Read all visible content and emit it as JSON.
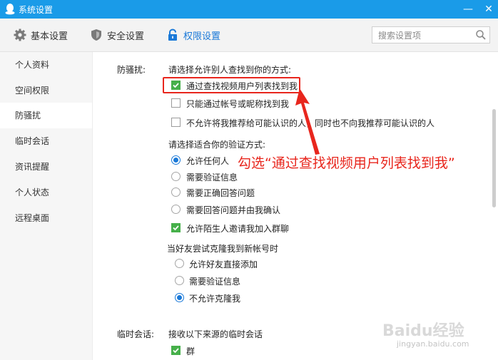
{
  "window": {
    "title": "系统设置",
    "minimize_label": "—",
    "close_label": "✕"
  },
  "toolbar": {
    "tabs": [
      {
        "label": "基本设置",
        "icon": "gear-icon"
      },
      {
        "label": "安全设置",
        "icon": "shield-icon"
      },
      {
        "label": "权限设置",
        "icon": "lock-icon",
        "active": true
      }
    ],
    "search_placeholder": "搜索设置项"
  },
  "sidebar": {
    "items": [
      {
        "label": "个人资料"
      },
      {
        "label": "空间权限"
      },
      {
        "label": "防骚扰",
        "active": true
      },
      {
        "label": "临时会话"
      },
      {
        "label": "资讯提醒"
      },
      {
        "label": "个人状态"
      },
      {
        "label": "远程桌面"
      }
    ]
  },
  "anti_harassment": {
    "section_label": "防骚扰:",
    "find_me_prompt": "请选择允许别人查找到你的方式:",
    "find_options": [
      {
        "label": "通过查找视频用户列表找到我",
        "checked": true
      },
      {
        "label": "只能通过帐号或昵称找到我",
        "checked": false
      },
      {
        "label": "不允许将我推荐给可能认识的人，同时也不向我推荐可能认识的人",
        "checked": false
      }
    ],
    "verify_prompt": "请选择适合你的验证方式:",
    "verify_options": [
      {
        "label": "允许任何人",
        "selected": true
      },
      {
        "label": "需要验证信息",
        "selected": false
      },
      {
        "label": "需要正确回答问题",
        "selected": false
      },
      {
        "label": "需要回答问题并由我确认",
        "selected": false
      }
    ],
    "group_invite": {
      "label": "允许陌生人邀请我加入群聊",
      "checked": true
    },
    "clone_prompt": "当好友尝试克隆我到新帐号时",
    "clone_options": [
      {
        "label": "允许好友直接添加",
        "selected": false
      },
      {
        "label": "需要验证信息",
        "selected": false
      },
      {
        "label": "不允许克隆我",
        "selected": true
      }
    ]
  },
  "temp_session": {
    "section_label": "临时会话:",
    "prompt": "接收以下来源的临时会话",
    "options": [
      {
        "label": "群",
        "checked": true
      }
    ]
  },
  "annotation": {
    "text": "勾选“通过查找视频用户列表找到我”"
  },
  "watermark": {
    "logo": "Baidu经验",
    "url": "jingyan.baidu.com"
  },
  "colors": {
    "titlebar": "#1a9be8",
    "accent": "#1a79d8",
    "checkbox_checked": "#46b04a",
    "annotation_red": "#e8261d"
  }
}
